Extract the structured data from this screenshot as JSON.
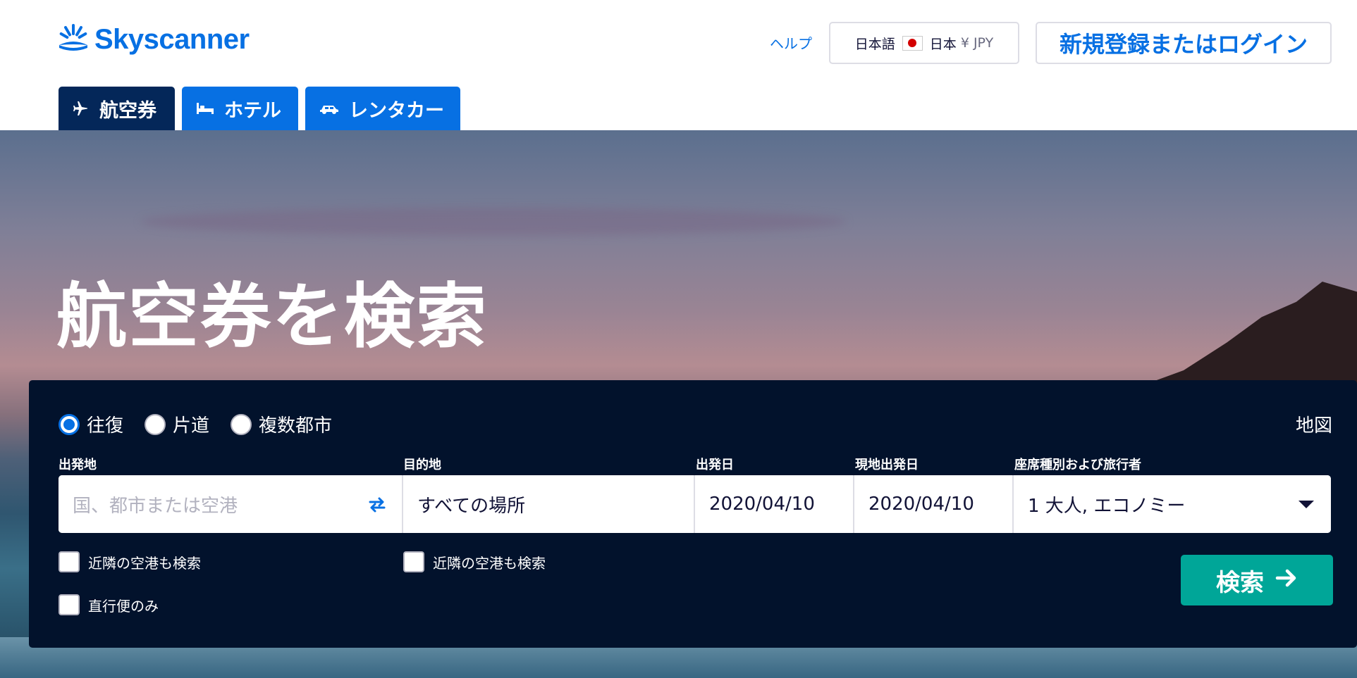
{
  "header": {
    "brand": "Skyscanner",
    "help": "ヘルプ",
    "locale": {
      "language": "日本語",
      "country": "日本",
      "currency": "¥ JPY"
    },
    "login": "新規登録またはログイン"
  },
  "tabs": [
    {
      "label": "航空券",
      "icon": "plane-icon",
      "active": true
    },
    {
      "label": "ホテル",
      "icon": "bed-icon",
      "active": false
    },
    {
      "label": "レンタカー",
      "icon": "car-icon",
      "active": false
    }
  ],
  "hero": {
    "title": "航空券を検索"
  },
  "search": {
    "trip_types": [
      "往復",
      "片道",
      "複数都市"
    ],
    "selected_trip_type": "往復",
    "map": "地図",
    "labels": {
      "origin": "出発地",
      "destination": "目的地",
      "depart": "出発日",
      "return": "現地出発日",
      "travellers": "座席種別および旅行者"
    },
    "origin_placeholder": "国、都市または空港",
    "destination_value": "すべての場所",
    "depart_value": "2020/04/10",
    "return_value": "2020/04/10",
    "travellers_value": "1 大人, エコノミー",
    "nearby_origin": "近隣の空港も検索",
    "nearby_destination": "近隣の空港も検索",
    "direct_only": "直行便のみ",
    "submit": "検索"
  },
  "colors": {
    "brand": "#0770e3",
    "panel": "#02122c",
    "search_button": "#00a698",
    "active_tab": "#042759"
  }
}
